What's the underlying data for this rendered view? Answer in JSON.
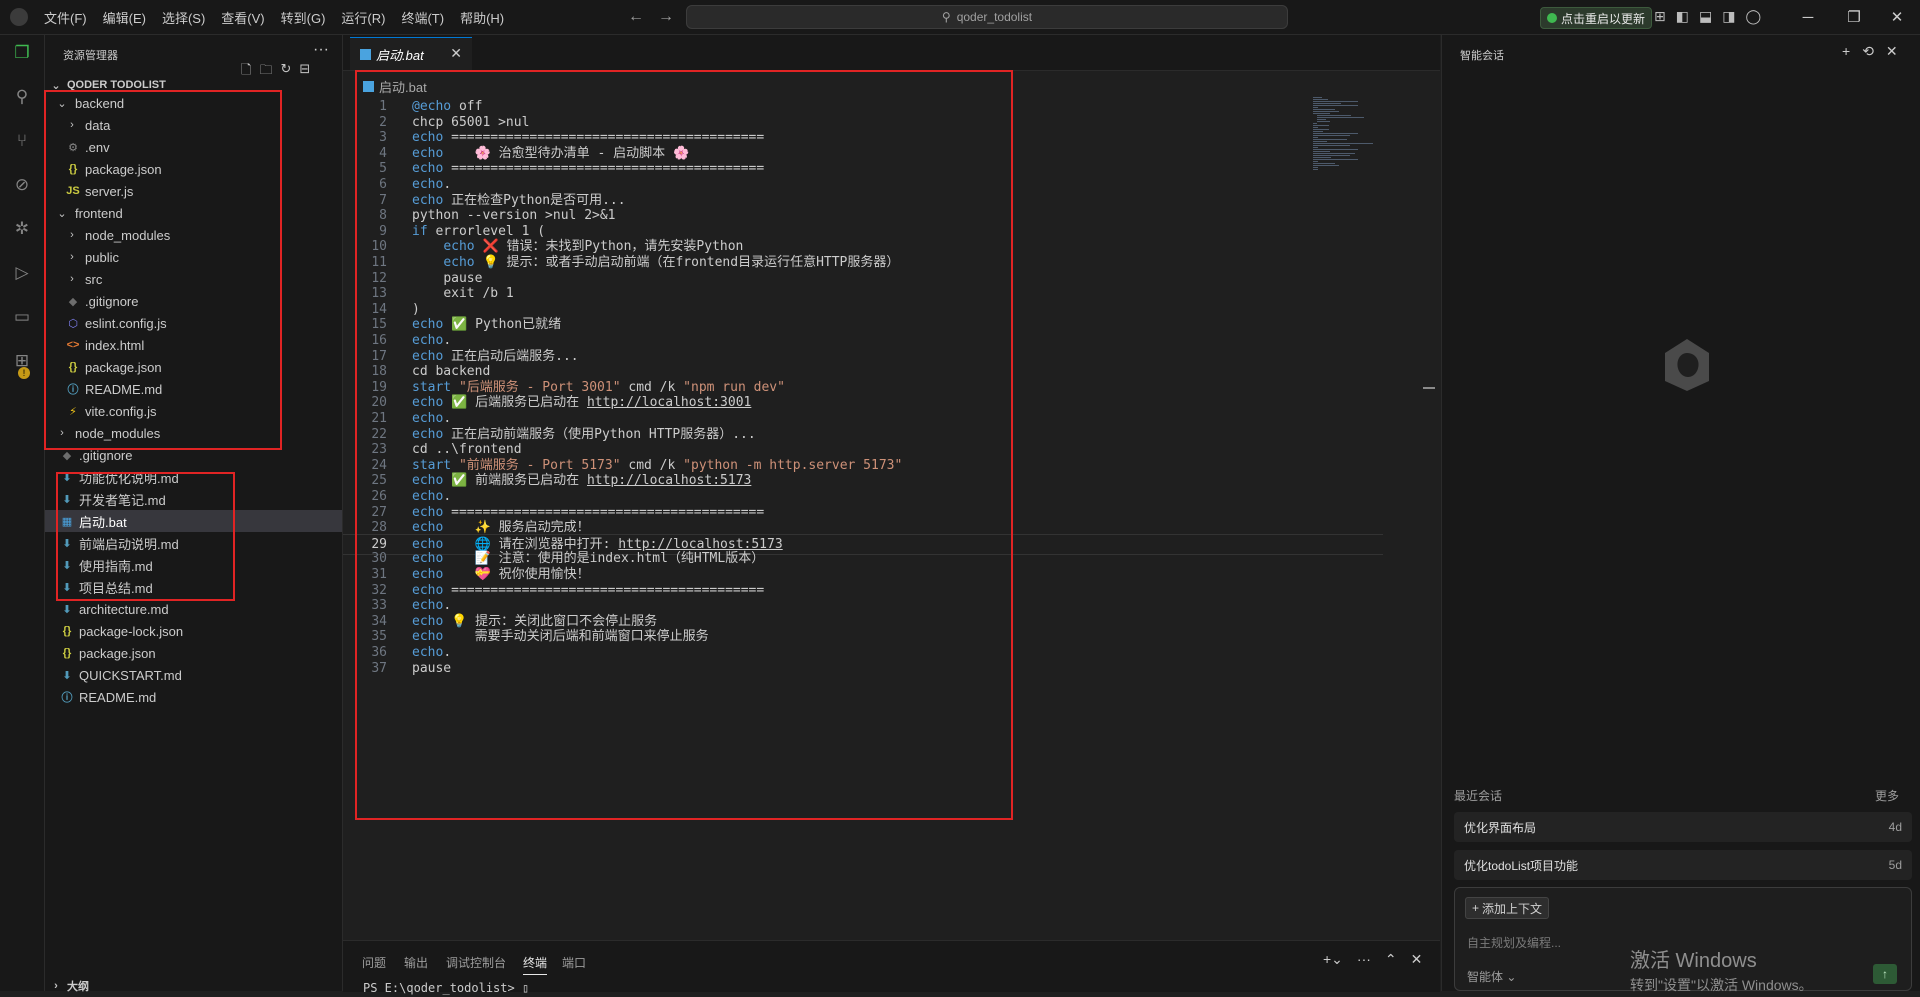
{
  "menu": [
    "文件(F)",
    "编辑(E)",
    "选择(S)",
    "查看(V)",
    "转到(G)",
    "运行(R)",
    "终端(T)",
    "帮助(H)"
  ],
  "search": {
    "text": "qoder_todolist"
  },
  "update_button": "点击重启以更新",
  "sidebar": {
    "title": "资源管理器",
    "root": "QODER TODOLIST",
    "outline": "大纲",
    "tree": [
      {
        "label": "backend",
        "kind": "folder-open",
        "indent": 1
      },
      {
        "label": "data",
        "kind": "folder",
        "indent": 2
      },
      {
        "label": ".env",
        "kind": "gear",
        "indent": 2
      },
      {
        "label": "package.json",
        "kind": "json",
        "indent": 2
      },
      {
        "label": "server.js",
        "kind": "js",
        "indent": 2
      },
      {
        "label": "frontend",
        "kind": "folder-open",
        "indent": 1
      },
      {
        "label": "node_modules",
        "kind": "folder",
        "indent": 2
      },
      {
        "label": "public",
        "kind": "folder",
        "indent": 2
      },
      {
        "label": "src",
        "kind": "folder",
        "indent": 2
      },
      {
        "label": ".gitignore",
        "kind": "git",
        "indent": 2
      },
      {
        "label": "eslint.config.js",
        "kind": "eslint",
        "indent": 2
      },
      {
        "label": "index.html",
        "kind": "html",
        "indent": 2
      },
      {
        "label": "package.json",
        "kind": "json",
        "indent": 2
      },
      {
        "label": "README.md",
        "kind": "info",
        "indent": 2
      },
      {
        "label": "vite.config.js",
        "kind": "vite",
        "indent": 2
      },
      {
        "label": "node_modules",
        "kind": "folder",
        "indent": 1
      },
      {
        "label": ".gitignore",
        "kind": "git",
        "indent": 1
      },
      {
        "label": "功能优化说明.md",
        "kind": "md",
        "indent": 1
      },
      {
        "label": "开发者笔记.md",
        "kind": "md",
        "indent": 1
      },
      {
        "label": "启动.bat",
        "kind": "bat",
        "indent": 1,
        "selected": true
      },
      {
        "label": "前端启动说明.md",
        "kind": "md",
        "indent": 1
      },
      {
        "label": "使用指南.md",
        "kind": "md",
        "indent": 1
      },
      {
        "label": "项目总结.md",
        "kind": "md",
        "indent": 1
      },
      {
        "label": "architecture.md",
        "kind": "md",
        "indent": 1
      },
      {
        "label": "package-lock.json",
        "kind": "json",
        "indent": 1
      },
      {
        "label": "package.json",
        "kind": "json",
        "indent": 1
      },
      {
        "label": "QUICKSTART.md",
        "kind": "md",
        "indent": 1
      },
      {
        "label": "README.md",
        "kind": "info",
        "indent": 1
      }
    ]
  },
  "editor": {
    "tab": "启动.bat",
    "breadcrumb": "启动.bat",
    "current_line": 29,
    "lines": [
      "@echo off",
      "chcp 65001 >nul",
      "echo ========================================",
      "echo    🌸 治愈型待办清单 - 启动脚本 🌸",
      "echo ========================================",
      "echo.",
      "echo 正在检查Python是否可用...",
      "python --version >nul 2>&1",
      "if errorlevel 1 (",
      "    echo ❌ 错误：未找到Python，请先安装Python",
      "    echo 💡 提示：或者手动启动前端（在frontend目录运行任意HTTP服务器）",
      "    pause",
      "    exit /b 1",
      ")",
      "echo ✅ Python已就绪",
      "echo.",
      "echo 正在启动后端服务...",
      "cd backend",
      "start \"后端服务 - Port 3001\" cmd /k \"npm run dev\"",
      "echo ✅ 后端服务已启动在 http://localhost:3001",
      "echo.",
      "echo 正在启动前端服务（使用Python HTTP服务器）...",
      "cd ..\\frontend",
      "start \"前端服务 - Port 5173\" cmd /k \"python -m http.server 5173\"",
      "echo ✅ 前端服务已启动在 http://localhost:5173",
      "echo.",
      "echo ========================================",
      "echo    ✨ 服务启动完成！",
      "echo    🌐 请在浏览器中打开: http://localhost:5173",
      "echo    📝 注意：使用的是index.html（纯HTML版本）",
      "echo    💝 祝你使用愉快！",
      "echo ========================================",
      "echo.",
      "echo 💡 提示：关闭此窗口不会停止服务",
      "echo    需要手动关闭后端和前端窗口来停止服务",
      "echo.",
      "pause"
    ]
  },
  "panel": {
    "tabs": [
      "问题",
      "输出",
      "调试控制台",
      "终端",
      "端口"
    ],
    "active_tab": "终端",
    "terminal_text": "PS E:\\qoder_todolist> ▯"
  },
  "chat": {
    "title": "智能会话",
    "recent_label": "最近会话",
    "more": "更多",
    "recent": [
      {
        "title": "优化界面布局",
        "age": "4d"
      },
      {
        "title": "优化todoList项目功能",
        "age": "5d"
      }
    ],
    "add_context": "添加上下文",
    "placeholder": "自主规划及编程...",
    "mode": "智能体"
  },
  "watermark": {
    "line1": "激活 Windows",
    "line2": "转到\"设置\"以激活 Windows。"
  }
}
